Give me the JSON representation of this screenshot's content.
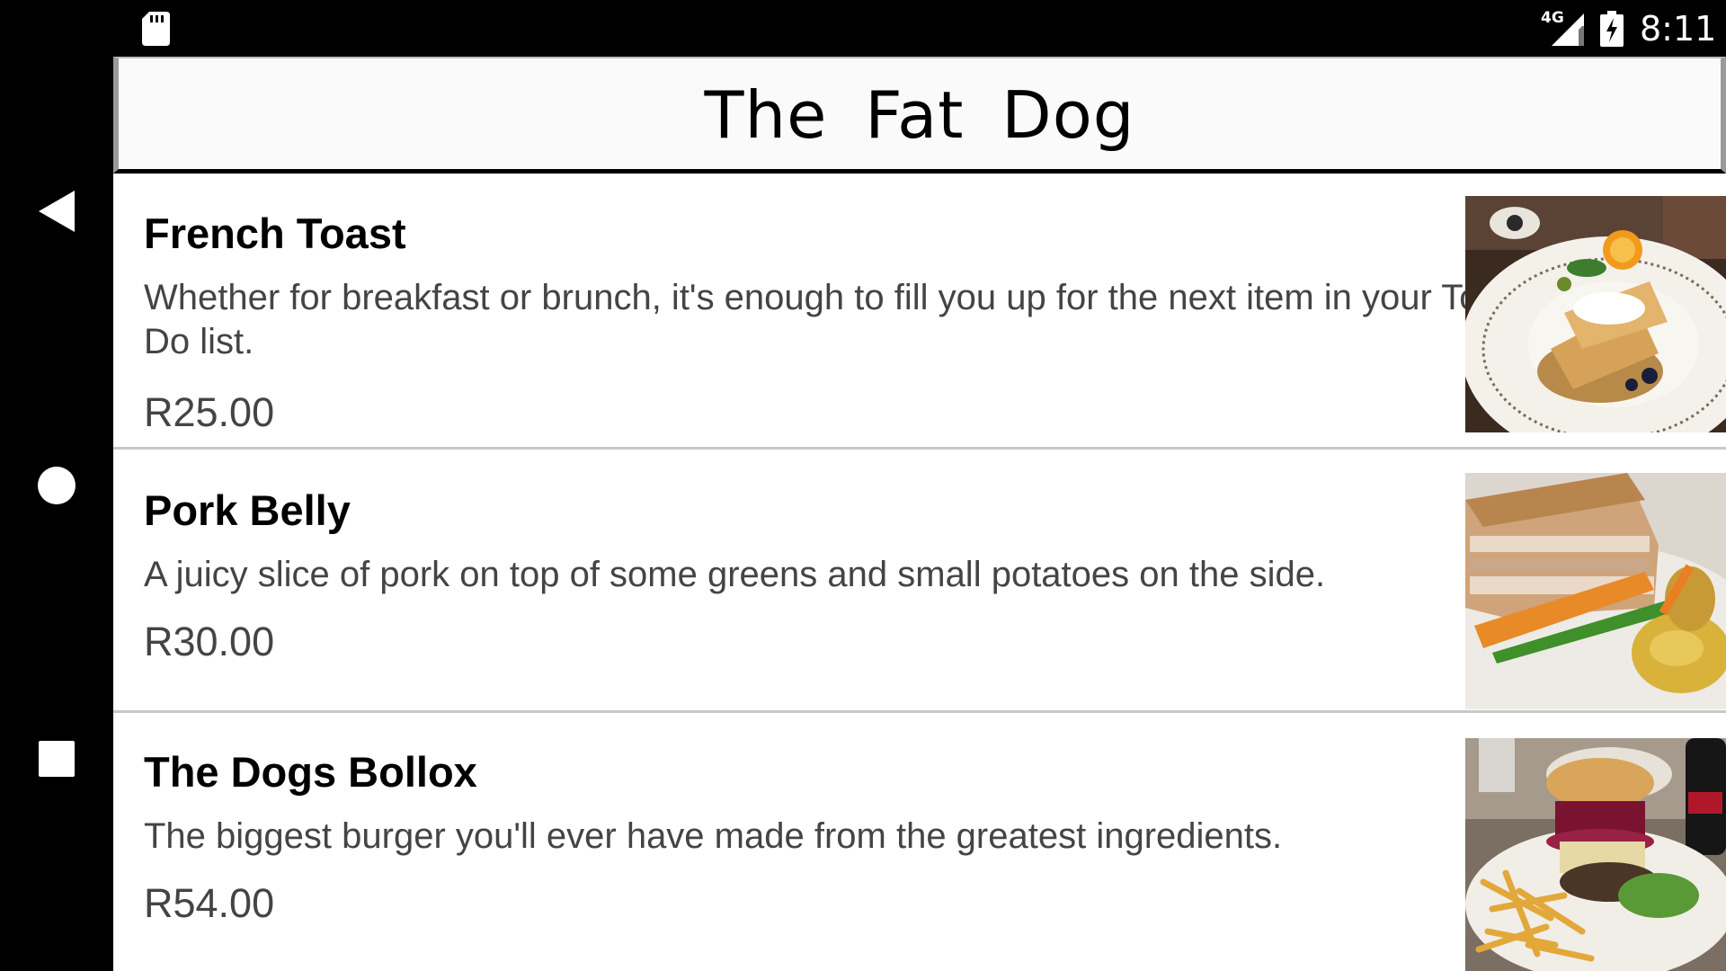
{
  "status_bar": {
    "network": "4G",
    "time": "8:11",
    "icons": [
      "sd-card-icon",
      "signal-icon",
      "battery-charging-icon"
    ]
  },
  "nav_bar": {
    "icons": [
      "back-icon",
      "home-icon",
      "recents-icon"
    ]
  },
  "app": {
    "title": "The  Fat  Dog"
  },
  "menu": [
    {
      "name": "French Toast",
      "description": "Whether for breakfast or brunch, it's enough to fill you up for the next item in your To-Do list.",
      "price": "R25.00",
      "photo_icon": "french-toast-photo"
    },
    {
      "name": "Pork Belly",
      "description": "A juicy slice of pork on top of some greens and small potatoes on the side.",
      "price": "R30.00",
      "photo_icon": "pork-belly-photo"
    },
    {
      "name": "The Dogs Bollox",
      "description": "The biggest burger you'll ever have made from the greatest ingredients.",
      "price": "R54.00",
      "photo_icon": "burger-photo"
    }
  ]
}
